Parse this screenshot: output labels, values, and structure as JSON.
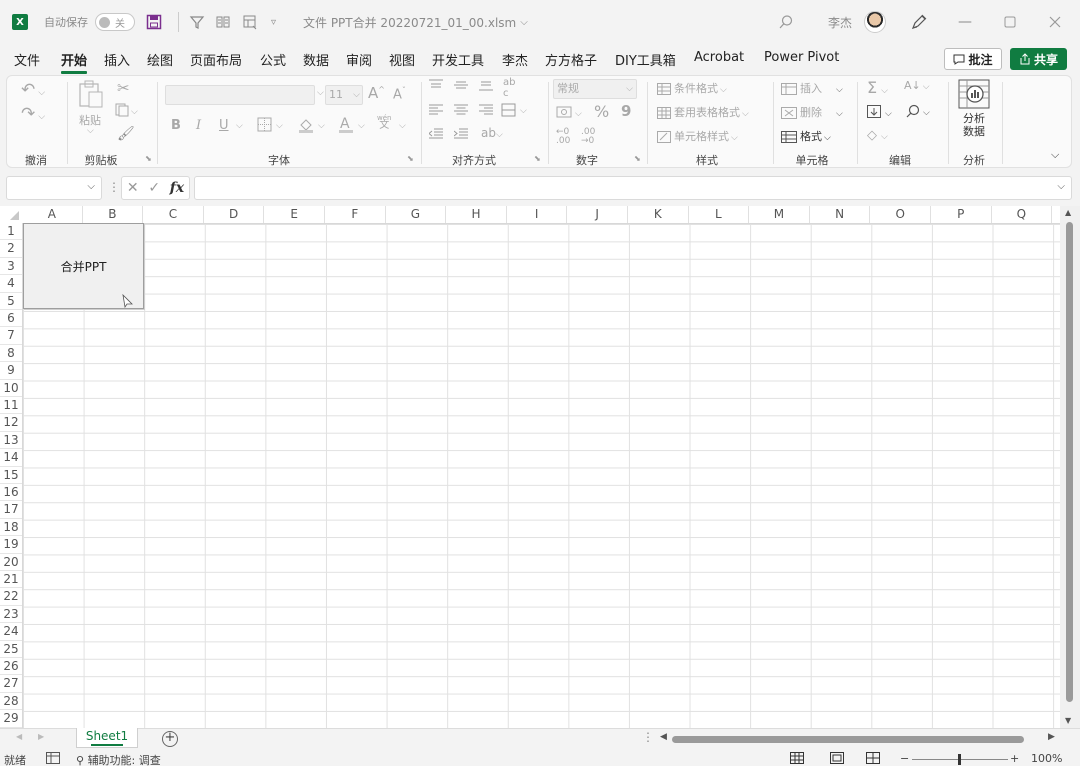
{
  "titlebar": {
    "autosave_label": "自动保存",
    "autosave_state": "关",
    "file_title": "文件 PPT合并 20220721_01_00.xlsm",
    "title_chevron": "⌵",
    "user_name": "李杰"
  },
  "menu": {
    "tabs": [
      "文件",
      "开始",
      "插入",
      "绘图",
      "页面布局",
      "公式",
      "数据",
      "审阅",
      "视图",
      "开发工具",
      "李杰",
      "方方格子",
      "DIY工具箱",
      "Acrobat",
      "Power Pivot"
    ],
    "active_tab": "开始",
    "comment_label": "批注",
    "share_label": "共享"
  },
  "ribbon": {
    "groups": {
      "undo": "撤消",
      "clipboard": "剪贴板",
      "font": "字体",
      "alignment": "对齐方式",
      "number": "数字",
      "styles": "样式",
      "cells": "单元格",
      "editing": "编辑",
      "analysis": "分析"
    },
    "paste_label": "粘贴",
    "font_size": "11",
    "number_format": "常规",
    "bold": "B",
    "italic": "I",
    "underline": "U",
    "wen": "wén",
    "wen_char": "文",
    "percent": "%",
    "comma": "9",
    "conditional_format": "条件格式",
    "table_format": "套用表格格式",
    "cell_styles": "单元格样式",
    "insert": "插入",
    "delete": "删除",
    "format": "格式",
    "analyze_data_1": "分析",
    "analyze_data_2": "数据"
  },
  "formula_bar": {
    "name_box_value": "",
    "formula_value": "",
    "fx_label": "fx"
  },
  "grid": {
    "columns": [
      "A",
      "B",
      "C",
      "D",
      "E",
      "F",
      "G",
      "H",
      "I",
      "J",
      "K",
      "L",
      "M",
      "N",
      "O",
      "P",
      "Q"
    ],
    "rows": [
      "1",
      "2",
      "3",
      "4",
      "5",
      "6",
      "7",
      "8",
      "9",
      "10",
      "11",
      "12",
      "13",
      "14",
      "15",
      "16",
      "17",
      "18",
      "19",
      "20",
      "21",
      "22",
      "23",
      "24",
      "25",
      "26",
      "27",
      "28",
      "29"
    ]
  },
  "merge_button_label": "合并PPT",
  "sheets": {
    "tabs": [
      "Sheet1"
    ],
    "add_label": "+"
  },
  "status": {
    "ready": "就绪",
    "accessibility": "辅助功能: 调查",
    "zoom": "100%",
    "zoom_minus": "−",
    "zoom_plus": "+"
  },
  "colors": {
    "accent": "#107c41"
  }
}
